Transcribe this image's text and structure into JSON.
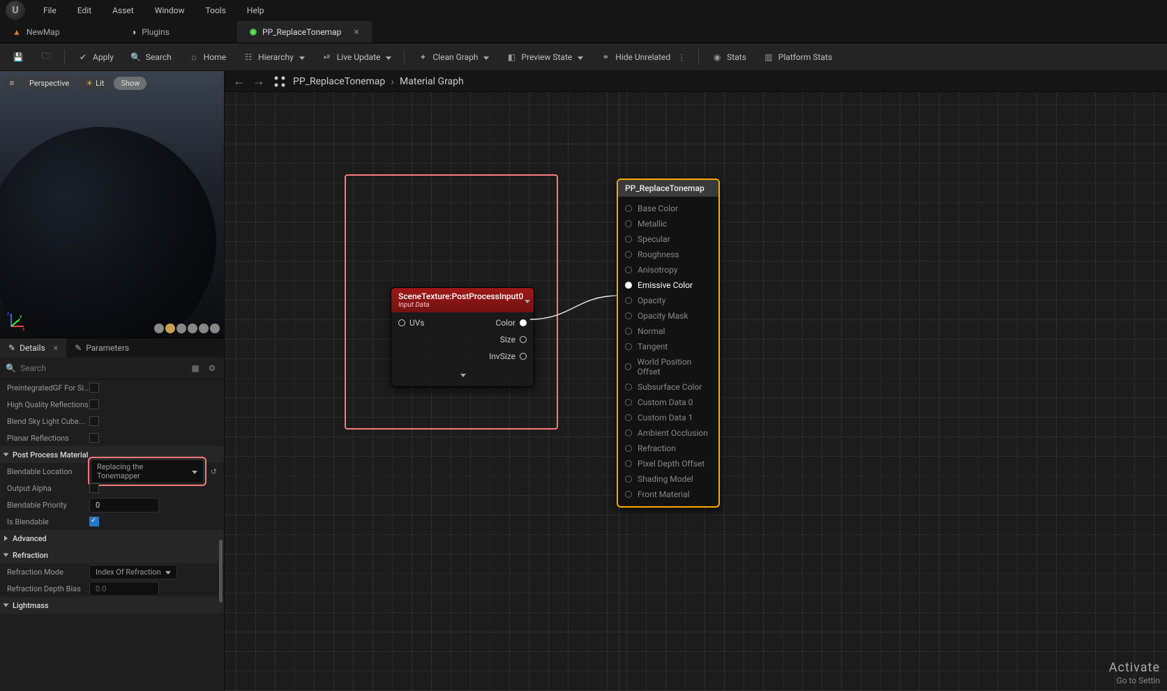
{
  "menubar": {
    "items": [
      "File",
      "Edit",
      "Asset",
      "Window",
      "Tools",
      "Help"
    ]
  },
  "doctabs": [
    {
      "label": "NewMap",
      "icon": "level",
      "active": false
    },
    {
      "label": "Plugins",
      "icon": "plugin",
      "active": false
    },
    {
      "label": "PP_ReplaceTonemap",
      "icon": "material",
      "active": true,
      "closable": true
    }
  ],
  "toolbar": {
    "save": "",
    "browse": "",
    "apply": "Apply",
    "search": "Search",
    "home": "Home",
    "hierarchy": "Hierarchy",
    "live_update": "Live Update",
    "clean_graph": "Clean Graph",
    "preview_state": "Preview State",
    "hide_unrelated": "Hide Unrelated",
    "stats": "Stats",
    "platform_stats": "Platform Stats"
  },
  "viewport": {
    "perspective": "Perspective",
    "lit": "Lit",
    "show": "Show"
  },
  "panel_tabs": {
    "details": "Details",
    "parameters": "Parameters"
  },
  "search_placeholder": "Search",
  "details": {
    "rows_checkbox": [
      {
        "label": "PreintegratedGF For Si...",
        "checked": false
      },
      {
        "label": "High Quality Reflections",
        "checked": false
      },
      {
        "label": "Blend Sky Light Cube...",
        "checked": false
      },
      {
        "label": "Planar Reflections",
        "checked": false
      }
    ],
    "section_ppm": "Post Process Material",
    "blendable_location_label": "Blendable Location",
    "blendable_location_value": "Replacing the Tonemapper",
    "output_alpha_label": "Output Alpha",
    "blendable_priority_label": "Blendable Priority",
    "blendable_priority_value": "0",
    "is_blendable_label": "Is Blendable",
    "advanced": "Advanced",
    "section_refraction": "Refraction",
    "refraction_mode_label": "Refraction Mode",
    "refraction_mode_value": "Index Of Refraction",
    "refraction_depth_label": "Refraction Depth Bias",
    "refraction_depth_value": "0.0",
    "section_lightmass": "Lightmass"
  },
  "breadcrumb": {
    "asset": "PP_ReplaceTonemap",
    "graph": "Material Graph"
  },
  "scene_node": {
    "title": "SceneTexture:PostProcessInput0",
    "subtitle": "Input Data",
    "in_uvs": "UVs",
    "out_color": "Color",
    "out_size": "Size",
    "out_invsize": "InvSize"
  },
  "mat_node": {
    "title": "PP_ReplaceTonemap",
    "inputs": [
      "Base Color",
      "Metallic",
      "Specular",
      "Roughness",
      "Anisotropy",
      "Emissive Color",
      "Opacity",
      "Opacity Mask",
      "Normal",
      "Tangent",
      "World Position Offset",
      "Subsurface Color",
      "Custom Data 0",
      "Custom Data 1",
      "Ambient Occlusion",
      "Refraction",
      "Pixel Depth Offset",
      "Shading Model",
      "Front Material"
    ],
    "active_index": 5
  },
  "watermark": {
    "line1": "Activate",
    "line2": "Go to Settin"
  }
}
